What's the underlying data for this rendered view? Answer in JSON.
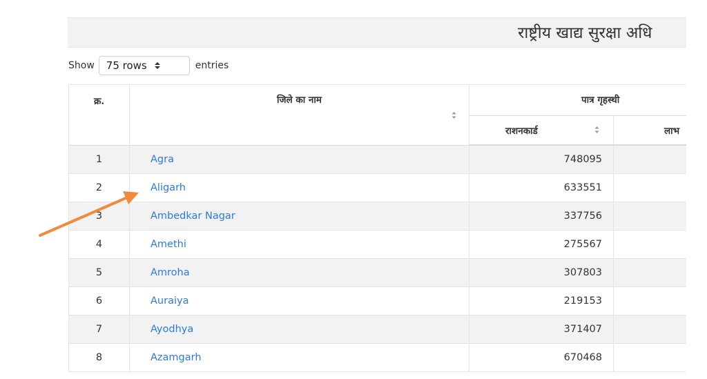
{
  "header": {
    "title": "राष्ट्रीय खाद्य सुरक्षा अधि"
  },
  "length_control": {
    "show_label": "Show",
    "selected_option": "75 rows",
    "entries_label": "entries"
  },
  "table": {
    "columns": {
      "sno": "क्र.",
      "district": "जिले का नाम",
      "group": "पात्र गृहस्थी",
      "ration_cards": "राशनकार्ड",
      "beneficiaries": "लाभ"
    },
    "rows": [
      {
        "sno": "1",
        "district": "Agra",
        "ration_cards": "748095"
      },
      {
        "sno": "2",
        "district": "Aligarh",
        "ration_cards": "633551"
      },
      {
        "sno": "3",
        "district": "Ambedkar Nagar",
        "ration_cards": "337756"
      },
      {
        "sno": "4",
        "district": "Amethi",
        "ration_cards": "275567"
      },
      {
        "sno": "5",
        "district": "Amroha",
        "ration_cards": "307803"
      },
      {
        "sno": "6",
        "district": "Auraiya",
        "ration_cards": "219153"
      },
      {
        "sno": "7",
        "district": "Ayodhya",
        "ration_cards": "371407"
      },
      {
        "sno": "8",
        "district": "Azamgarh",
        "ration_cards": "670468"
      }
    ]
  },
  "colors": {
    "link": "#2a7ae2",
    "annotation_arrow": "#f08a3c",
    "stripe": "#f2f2f2"
  },
  "icons": {
    "sort": "sort-icon",
    "select_arrows": "chevron-up-down-icon",
    "annotation": "arrow-annotation-icon"
  }
}
